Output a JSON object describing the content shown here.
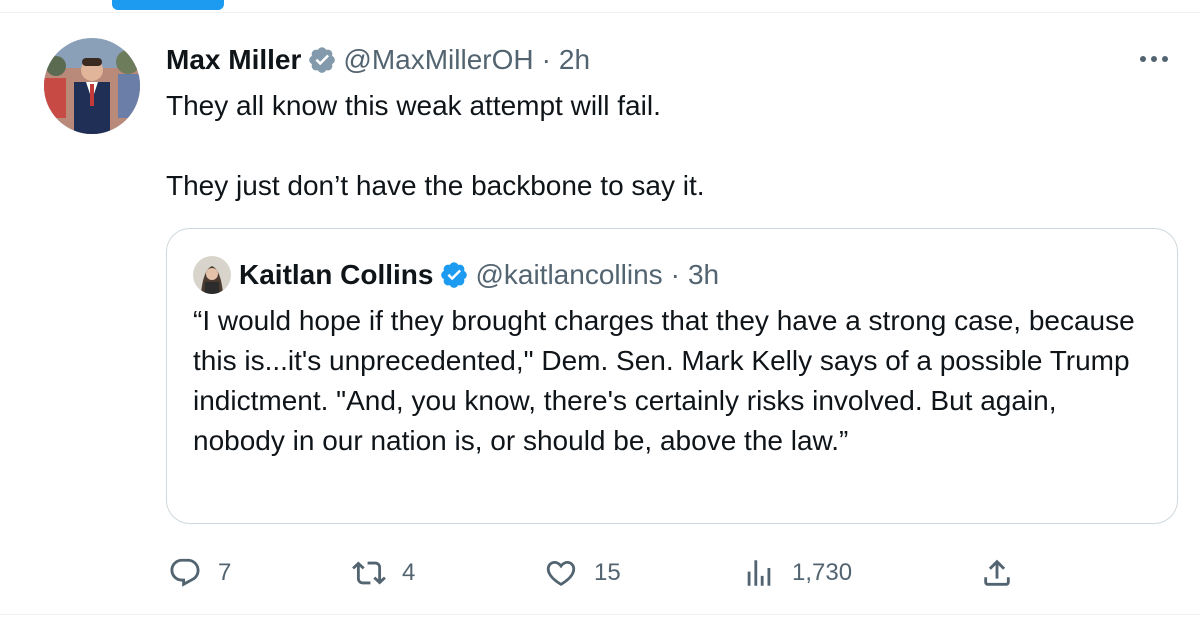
{
  "tweet": {
    "author_name": "Max Miller",
    "handle": "@MaxMillerOH",
    "separator": "·",
    "time": "2h",
    "text_line1": "They all know this weak attempt will fail.",
    "text_line2": "They just don’t have the backbone to say it."
  },
  "quote": {
    "author_name": "Kaitlan Collins",
    "handle": "@kaitlancollins",
    "separator": "·",
    "time": "3h",
    "text": "“I would hope if they brought charges that they have a strong case, because this is...it's unprecedented,\" Dem. Sen. Mark Kelly says of a possible Trump indictment. \"And, you know, there's certainly risks involved. But again, nobody in our nation is, or should be, above the law.”"
  },
  "actions": {
    "replies": "7",
    "retweets": "4",
    "likes": "15",
    "views": "1,730"
  },
  "icons": {
    "verified": "verified-badge-icon",
    "more": "more-icon",
    "reply": "reply-icon",
    "retweet": "retweet-icon",
    "like": "like-icon",
    "views": "views-icon",
    "share": "share-icon"
  },
  "colors": {
    "accent": "#1d9bf0",
    "text": "#0f1419",
    "secondary": "#536471",
    "border": "#cfd9de"
  }
}
